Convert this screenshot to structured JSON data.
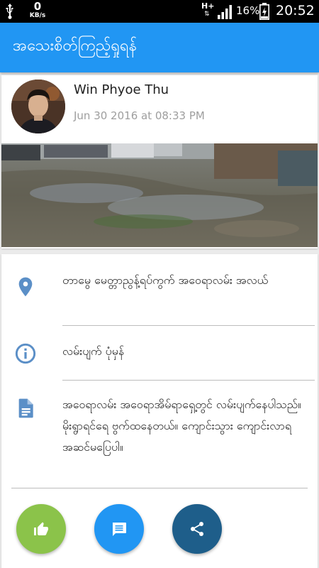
{
  "status_bar": {
    "network_speed": "0",
    "network_speed_unit": "KB/s",
    "network_type": "H+",
    "network_arrows": "⇅",
    "battery_percent": "16%",
    "time": "20:52",
    "icons": [
      "usb-icon",
      "signal-icon",
      "battery-charging-icon"
    ]
  },
  "app_bar": {
    "title": "အသေးစိတ်ကြည့်ရှုရန်"
  },
  "post": {
    "author_name": "Win Phyoe Thu",
    "date": "Jun 30 2016 at 08:33 PM",
    "avatar_icon": "user-avatar",
    "photo_icon": "flooded-street-photo"
  },
  "details": {
    "location": "တာမွေ မေတ္တာညွန့်ရပ်ကွက် အဝေရာလမ်း အလယ်",
    "category": "လမ်းပျက် ပုံမှန်",
    "description": "အဝေရာလမ်း အဝေရာအိမ်ရာရှေ့တွင် လမ်းပျက်နေပါသည်။ မိုးရွာရင်ရေ ဗွက်ထနေတယ်။ ကျောင်းသွား ကျောင်းလာရအဆင်မပြေပါ။",
    "icons": [
      "location-pin-icon",
      "info-icon",
      "document-icon"
    ]
  },
  "actions": {
    "like_icon": "thumbs-up-icon",
    "comment_icon": "comment-icon",
    "share_icon": "share-icon"
  },
  "colors": {
    "primary": "#2196f3",
    "like_button": "#8bc34a",
    "comment_button": "#2196f3",
    "share_button": "#1e5e8a",
    "icon_tint": "#5b8fc7"
  }
}
